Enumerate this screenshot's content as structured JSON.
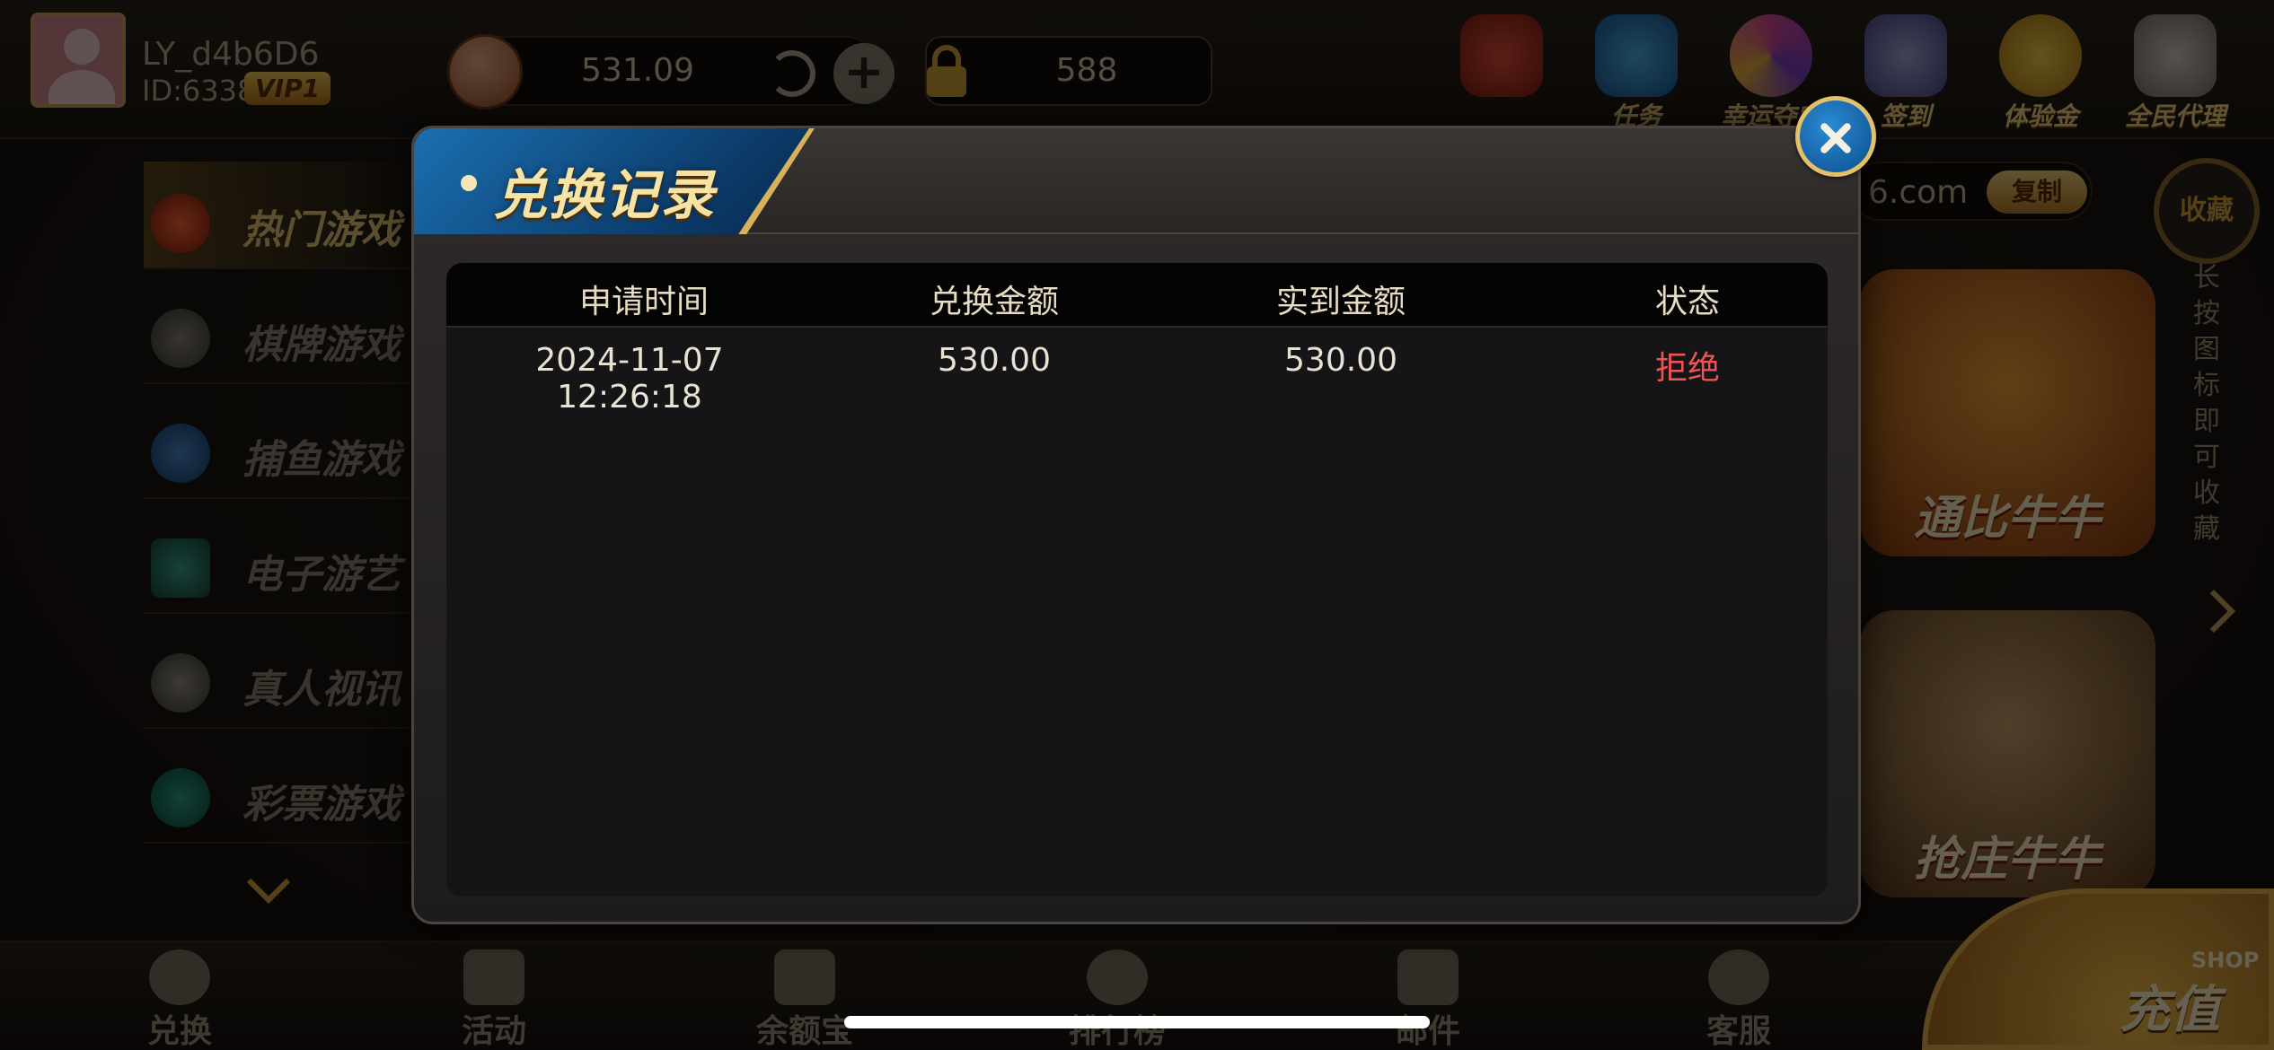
{
  "user": {
    "name": "LY_d4b6D6",
    "id": "ID:6338",
    "vip": "VIP1"
  },
  "wallet": {
    "balance": "531.09",
    "safe_balance": "588"
  },
  "top_icons": [
    {
      "label": "",
      "icon": "red-envelope-icon"
    },
    {
      "label": "任务",
      "icon": "gift-box-icon"
    },
    {
      "label": "幸运夺宝",
      "icon": "lucky-wheel-icon"
    },
    {
      "label": "签到",
      "icon": "check-in-icon"
    },
    {
      "label": "体验金",
      "icon": "yuan-coin-icon"
    },
    {
      "label": "全民代理",
      "icon": "megaphone-icon"
    }
  ],
  "sidebar": {
    "items": [
      {
        "label": "热门游戏",
        "icon": "hot-flame-icon"
      },
      {
        "label": "棋牌游戏",
        "icon": "spade-icon"
      },
      {
        "label": "捕鱼游戏",
        "icon": "shark-icon"
      },
      {
        "label": "电子游艺",
        "icon": "slot-machine-icon"
      },
      {
        "label": "真人视讯",
        "icon": "roulette-icon"
      },
      {
        "label": "彩票游戏",
        "icon": "lottery-icon"
      }
    ]
  },
  "domain": {
    "text": "6.com",
    "copy_label": "复制"
  },
  "favorite": {
    "label": "收藏",
    "hint": "长按图标即可收藏"
  },
  "games": [
    {
      "label": "通比牛牛"
    },
    {
      "label": "抢庄牛牛"
    }
  ],
  "bottom_nav": [
    {
      "label": "兑换",
      "icon": "exchange-icon"
    },
    {
      "label": "活动",
      "icon": "gift-icon"
    },
    {
      "label": "余额宝",
      "icon": "briefcase-icon"
    },
    {
      "label": "排行榜",
      "icon": "medal-icon"
    },
    {
      "label": "邮件",
      "icon": "mail-icon"
    },
    {
      "label": "客服",
      "icon": "headset-icon"
    }
  ],
  "shop": {
    "label": "充值",
    "tag": "SHOP"
  },
  "modal": {
    "title": "兑换记录",
    "columns": [
      "申请时间",
      "兑换金额",
      "实到金额",
      "状态"
    ],
    "rows": [
      {
        "time": "2024-11-07 12:26:18",
        "amount": "530.00",
        "received": "530.00",
        "status": "拒绝"
      }
    ]
  },
  "colors": {
    "status_rejected": "#ef5454",
    "title_tab": "#1b6fb0",
    "gold_accent": "#d6a339"
  }
}
